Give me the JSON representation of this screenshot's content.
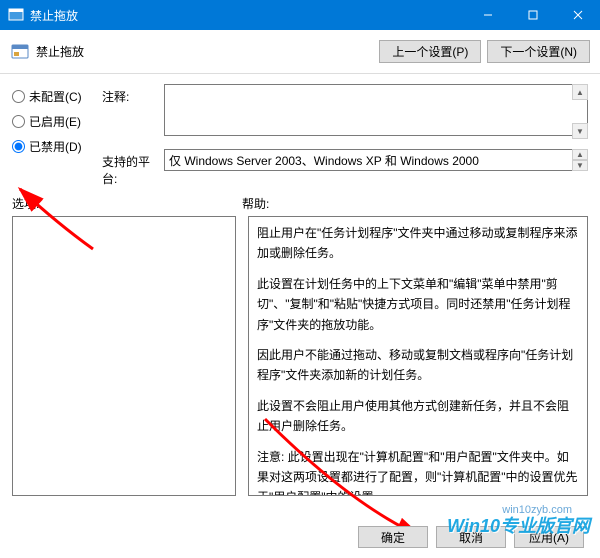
{
  "window": {
    "title": "禁止拖放"
  },
  "toolbar": {
    "title": "禁止拖放",
    "prev": "上一个设置(P)",
    "next": "下一个设置(N)"
  },
  "radios": {
    "not_configured": "未配置(C)",
    "enabled": "已启用(E)",
    "disabled": "已禁用(D)"
  },
  "fields": {
    "comment_label": "注释:",
    "platform_label": "支持的平台:",
    "platform_value": "仅 Windows Server 2003、Windows XP 和 Windows 2000"
  },
  "sections": {
    "options": "选项:",
    "help": "帮助:"
  },
  "help": {
    "p1": "阻止用户在\"任务计划程序\"文件夹中通过移动或复制程序来添加或删除任务。",
    "p2": "此设置在计划任务中的上下文菜单和\"编辑\"菜单中禁用\"剪切\"、\"复制\"和\"粘贴\"快捷方式项目。同时还禁用\"任务计划程序\"文件夹的拖放功能。",
    "p3": "因此用户不能通过拖动、移动或复制文档或程序向\"任务计划程序\"文件夹添加新的计划任务。",
    "p4": "此设置不会阻止用户使用其他方式创建新任务，并且不会阻止用户删除任务。",
    "p5": "注意: 此设置出现在\"计算机配置\"和\"用户配置\"文件夹中。如果对这两项设置都进行了配置，则\"计算机配置\"中的设置优先于\"用户配置\"中的设置。"
  },
  "buttons": {
    "ok": "确定",
    "cancel": "取消",
    "apply": "应用(A)"
  },
  "watermark": {
    "url": "win10zyb.com",
    "text": "Win10专业版官网"
  }
}
